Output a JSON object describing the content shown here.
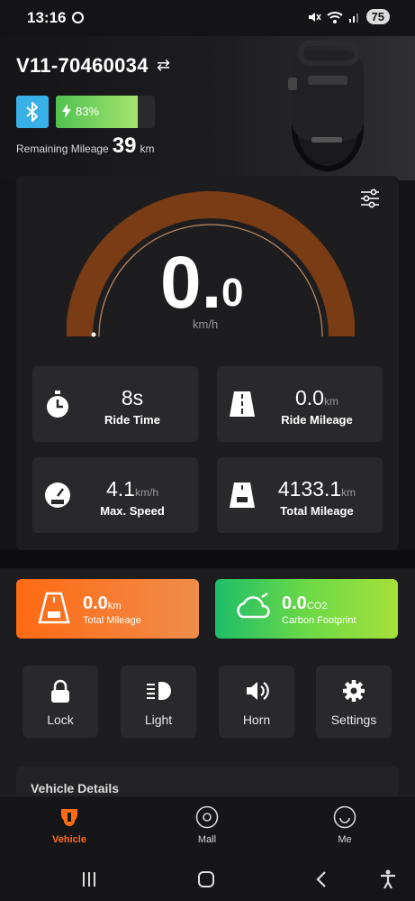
{
  "status_bar": {
    "time": "13:16",
    "battery": "75"
  },
  "vehicle": {
    "name": "V11-70460034",
    "battery_percent_label": "83%",
    "battery_level": 0.83,
    "remaining_label": "Remaining Mileage",
    "remaining_value": "39",
    "remaining_unit": "km"
  },
  "dashboard": {
    "speed_int": "0.",
    "speed_dec": "0",
    "speed_unit": "km/h",
    "stats": [
      {
        "value": "8s",
        "unit": "",
        "label": "Ride Time",
        "icon": "stopwatch-icon"
      },
      {
        "value": "0.0",
        "unit": "km",
        "label": "Ride Mileage",
        "icon": "road-icon"
      },
      {
        "value": "4.1",
        "unit": "km/h",
        "label": "Max. Speed",
        "icon": "speedometer-max-icon"
      },
      {
        "value": "4133.1",
        "unit": "km",
        "label": "Total Mileage",
        "icon": "odometer-road-icon"
      }
    ]
  },
  "summary": {
    "total": {
      "value": "0.0",
      "unit": "km",
      "label": "Total Mileage"
    },
    "carbon": {
      "value": "0.0",
      "unit": "CO2",
      "label": "Carbon Footprint"
    }
  },
  "controls": [
    {
      "label": "Lock",
      "icon": "lock-icon"
    },
    {
      "label": "Light",
      "icon": "headlight-icon"
    },
    {
      "label": "Horn",
      "icon": "horn-icon"
    },
    {
      "label": "Settings",
      "icon": "gear-icon"
    }
  ],
  "details_peek": "Vehicle Details",
  "tabs": [
    {
      "label": "Vehicle",
      "icon": "vehicle-icon"
    },
    {
      "label": "Mall",
      "icon": "mall-icon"
    },
    {
      "label": "Me",
      "icon": "smiley-icon"
    }
  ],
  "colors": {
    "accent": "#ff6a14",
    "bluetooth": "#3ab0e8",
    "battery_green": "#4fc24f",
    "arc_brown": "#7a3c15"
  }
}
